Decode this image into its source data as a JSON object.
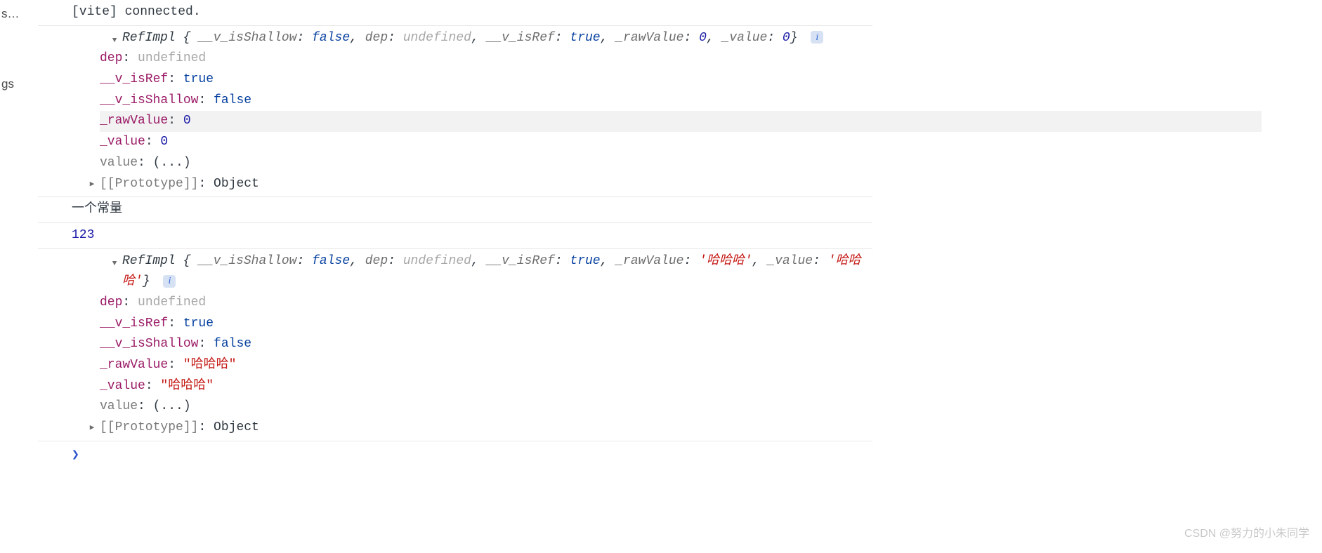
{
  "sidebar": {
    "item1": "s…",
    "item2": "gs"
  },
  "logs": {
    "l0": {
      "text": "[vite] connected."
    },
    "l1_summary": {
      "classname": "RefImpl",
      "open_brace": "{",
      "entries": {
        "e0": {
          "k": "__v_isShallow",
          "v": "false",
          "vt": "bool"
        },
        "e1": {
          "k": "dep",
          "v": "undefined",
          "vt": "undef"
        },
        "e2": {
          "k": "__v_isRef",
          "v": "true",
          "vt": "bool"
        },
        "e3": {
          "k": "_rawValue",
          "v": "0",
          "vt": "num"
        },
        "e4": {
          "k": "_value",
          "v": "0",
          "vt": "num"
        }
      },
      "close_brace": "}",
      "info": "i"
    },
    "l1_props": {
      "p0": {
        "k": "dep",
        "v": "undefined",
        "kc": "kname",
        "vc": "kundef"
      },
      "p1": {
        "k": "__v_isRef",
        "v": "true",
        "kc": "kname",
        "vc": "kbool"
      },
      "p2": {
        "k": "__v_isShallow",
        "v": "false",
        "kc": "kname",
        "vc": "kbool"
      },
      "p3": {
        "k": "_rawValue",
        "v": "0",
        "kc": "kname",
        "vc": "knum",
        "hl": true
      },
      "p4": {
        "k": "_value",
        "v": "0",
        "kc": "kname",
        "vc": "knum"
      },
      "p5": {
        "k": "value",
        "v": "(...)",
        "kc": "kname-dim",
        "vc": "getter"
      },
      "proto": {
        "k": "[[Prototype]]",
        "v": "Object"
      }
    },
    "l2": {
      "text": "一个常量"
    },
    "l3": {
      "text": "123"
    },
    "l4_summary": {
      "classname": "RefImpl",
      "open_brace": "{",
      "entries": {
        "e0": {
          "k": "__v_isShallow",
          "v": "false",
          "vt": "bool"
        },
        "e1": {
          "k": "dep",
          "v": "undefined",
          "vt": "undef"
        },
        "e2": {
          "k": "__v_isRef",
          "v": "true",
          "vt": "bool"
        },
        "e3": {
          "k": "_rawValue",
          "v": "'哈哈哈'",
          "vt": "str"
        },
        "e4": {
          "k": "_value",
          "v": "'哈哈哈'",
          "vt": "str"
        }
      },
      "close_brace": "}",
      "info": "i"
    },
    "l4_props": {
      "p0": {
        "k": "dep",
        "v": "undefined",
        "kc": "kname",
        "vc": "kundef"
      },
      "p1": {
        "k": "__v_isRef",
        "v": "true",
        "kc": "kname",
        "vc": "kbool"
      },
      "p2": {
        "k": "__v_isShallow",
        "v": "false",
        "kc": "kname",
        "vc": "kbool"
      },
      "p3": {
        "k": "_rawValue",
        "v": "\"哈哈哈\"",
        "kc": "kname",
        "vc": "kstr"
      },
      "p4": {
        "k": "_value",
        "v": "\"哈哈哈\"",
        "kc": "kname",
        "vc": "kstr"
      },
      "p5": {
        "k": "value",
        "v": "(...)",
        "kc": "kname-dim",
        "vc": "getter"
      },
      "proto": {
        "k": "[[Prototype]]",
        "v": "Object"
      }
    }
  },
  "prompt": "❯",
  "watermark": "CSDN @努力的小朱同学"
}
